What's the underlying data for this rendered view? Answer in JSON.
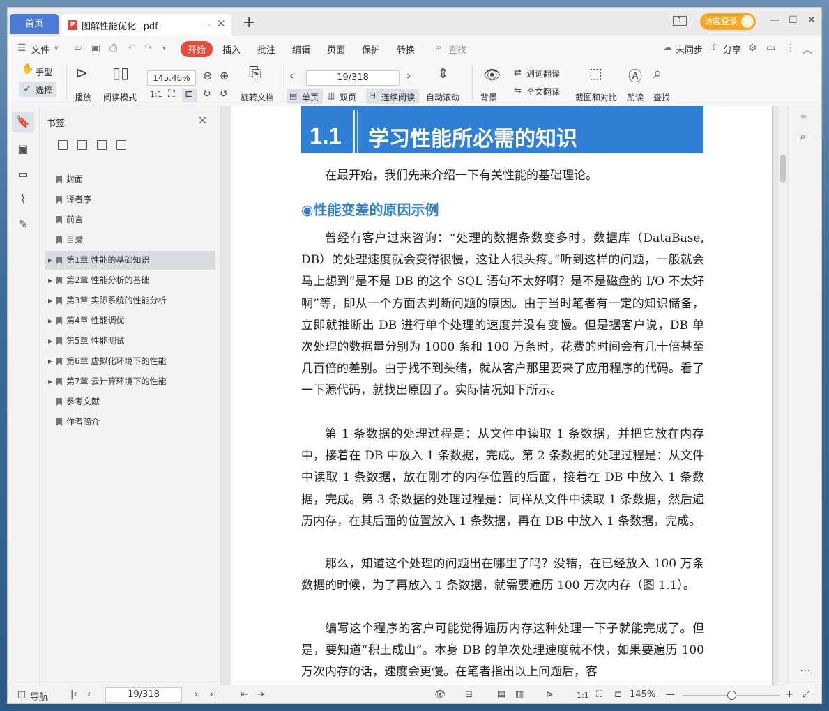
{
  "titlebar": {
    "home_tab": "首页",
    "doc_tab": "图解性能优化_.pdf",
    "page_badge": "1",
    "login": "访客登录"
  },
  "menu": {
    "file": "文件",
    "items": [
      "开始",
      "插入",
      "批注",
      "编辑",
      "页面",
      "保护",
      "转换"
    ],
    "search": "查找",
    "sync": "未同步",
    "share": "分享"
  },
  "toolbar": {
    "hand": "手型",
    "select": "选择",
    "play": "播放",
    "read_mode": "阅读模式",
    "zoom": "145.46%",
    "rotate": "旋转文档",
    "page_field": "19/318",
    "single": "单页",
    "double": "双页",
    "continuous": "连续阅读",
    "autoscroll": "自动滚动",
    "background": "背景",
    "word_translate": "划词翻译",
    "full_translate": "全文翻译",
    "screenshot": "截图和对比",
    "read_aloud": "朗读",
    "find": "查找"
  },
  "sidebar": {
    "title": "书签",
    "items": [
      {
        "label": "封面",
        "expandable": false,
        "selected": false
      },
      {
        "label": "译者序",
        "expandable": false,
        "selected": false
      },
      {
        "label": "前言",
        "expandable": false,
        "selected": false
      },
      {
        "label": "目录",
        "expandable": false,
        "selected": false
      },
      {
        "label": "第1章 性能的基础知识",
        "expandable": true,
        "selected": true
      },
      {
        "label": "第2章 性能分析的基础",
        "expandable": true,
        "selected": false
      },
      {
        "label": "第3章 实际系统的性能分析",
        "expandable": true,
        "selected": false
      },
      {
        "label": "第4章 性能调优",
        "expandable": true,
        "selected": false
      },
      {
        "label": "第5章 性能测试",
        "expandable": true,
        "selected": false
      },
      {
        "label": "第6章 虚拟化环境下的性能",
        "expandable": true,
        "selected": false
      },
      {
        "label": "第7章 云计算环境下的性能",
        "expandable": true,
        "selected": false
      },
      {
        "label": "参考文献",
        "expandable": false,
        "selected": false
      },
      {
        "label": "作者简介",
        "expandable": false,
        "selected": false
      }
    ]
  },
  "document": {
    "chapter_num": "1.1",
    "chapter_title": "学习性能所必需的知识",
    "intro": "在最开始，我们先来介绍一下有关性能的基础理论。",
    "section": "◉性能变差的原因示例",
    "paragraphs": [
      "曾经有客户过来咨询：“处理的数据条数变多时，数据库（DataBase, DB）的处理速度就会变得很慢，这让人很头疼。”听到这样的问题，一般就会马上想到“是不是 DB 的这个 SQL 语句不太好啊？是不是磁盘的 I/O 不太好啊”等，即从一个方面去判断问题的原因。由于当时笔者有一定的知识储备，立即就推断出 DB 进行单个处理的速度并没有变慢。但是据客户说，DB 单次处理的数据量分别为 1000 条和 100 万条时，花费的时间会有几十倍甚至几百倍的差别。由于找不到头绪，就从客户那里要来了应用程序的代码。看了一下源代码，就找出原因了。实际情况如下所示。",
      "第 1 条数据的处理过程是：从文件中读取 1 条数据，并把它放在内存中，接着在 DB 中放入 1 条数据，完成。第 2 条数据的处理过程是：从文件中读取 1 条数据，放在刚才的内存位置的后面，接着在 DB 中放入 1 条数据，完成。第 3 条数据的处理过程是：同样从文件中读取 1 条数据，然后遍历内存，在其后面的位置放入 1 条数据，再在 DB 中放入 1 条数据，完成。",
      "那么，知道这个处理的问题出在哪里了吗？没错，在已经放入 100 万条数据的时候，为了再放入 1 条数据，就需要遍历 100 万次内存（图 1.1）。",
      "编写这个程序的客户可能觉得遍历内存这种处理一下子就能完成了。但是，要知道“积土成山”。本身 DB 的单次处理速度就不快，如果要遍历 100 万次内存的话，速度会更慢。在笔者指出以上问题后，客"
    ]
  },
  "statusbar": {
    "nav": "导航",
    "page_field": "19/318",
    "zoom": "145%"
  }
}
